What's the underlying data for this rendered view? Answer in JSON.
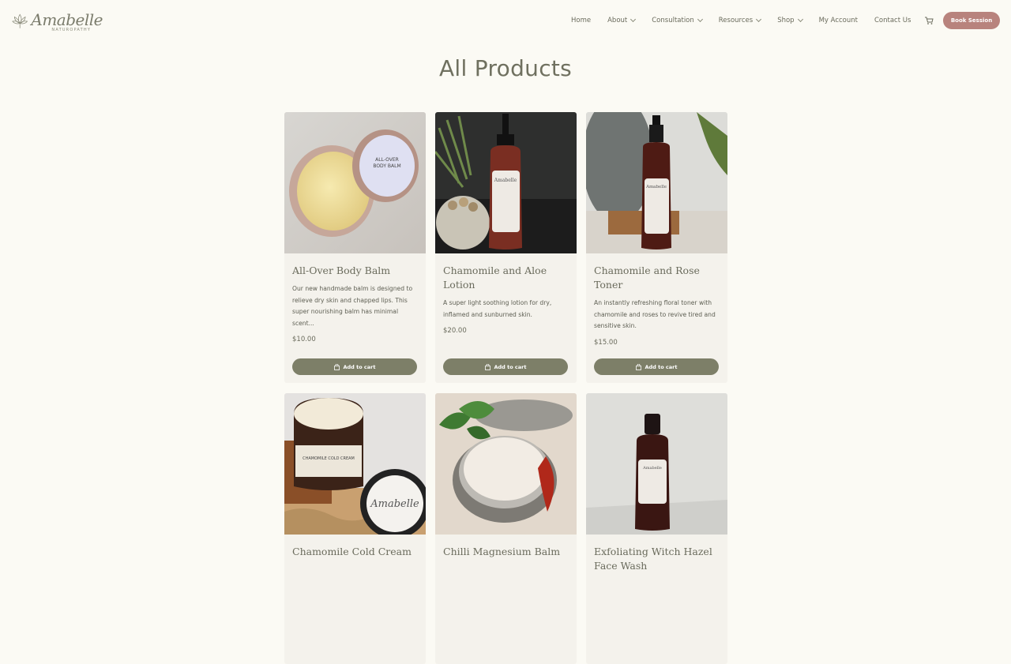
{
  "brand": {
    "name": "Amabelle",
    "tagline": "NATUROPATHY"
  },
  "nav": {
    "items": [
      {
        "label": "Home",
        "dropdown": false
      },
      {
        "label": "About",
        "dropdown": true
      },
      {
        "label": "Consultation",
        "dropdown": true
      },
      {
        "label": "Resources",
        "dropdown": true
      },
      {
        "label": "Shop",
        "dropdown": true
      },
      {
        "label": "My Account",
        "dropdown": false
      },
      {
        "label": "Contact Us",
        "dropdown": false
      }
    ],
    "cart_icon": "cart-icon",
    "book_label": "Book Session"
  },
  "page": {
    "title": "All Products"
  },
  "products": [
    {
      "title": "All-Over Body Balm",
      "desc": "Our new handmade balm is designed to relieve dry skin and chapped lips. This super nourishing balm has minimal scent...",
      "price": "$10.00",
      "button": "Add to cart"
    },
    {
      "title": "Chamomile and Aloe Lotion",
      "desc": "A super light soothing lotion for dry, inflamed and sunburned skin.",
      "price": "$20.00",
      "button": "Add to cart"
    },
    {
      "title": "Chamomile and Rose Toner",
      "desc": "An instantly refreshing floral toner with chamomile and roses to revive tired and sensitive skin.",
      "price": "$15.00",
      "button": "Add to cart"
    },
    {
      "title": "Chamomile Cold Cream"
    },
    {
      "title": "Chilli Magnesium Balm"
    },
    {
      "title": "Exfoliating Witch Hazel Face Wash"
    }
  ],
  "colors": {
    "background": "#fbfaf4",
    "accent": "#7d7f68",
    "book_button": "#b8837d",
    "card": "#f4f2ec"
  }
}
